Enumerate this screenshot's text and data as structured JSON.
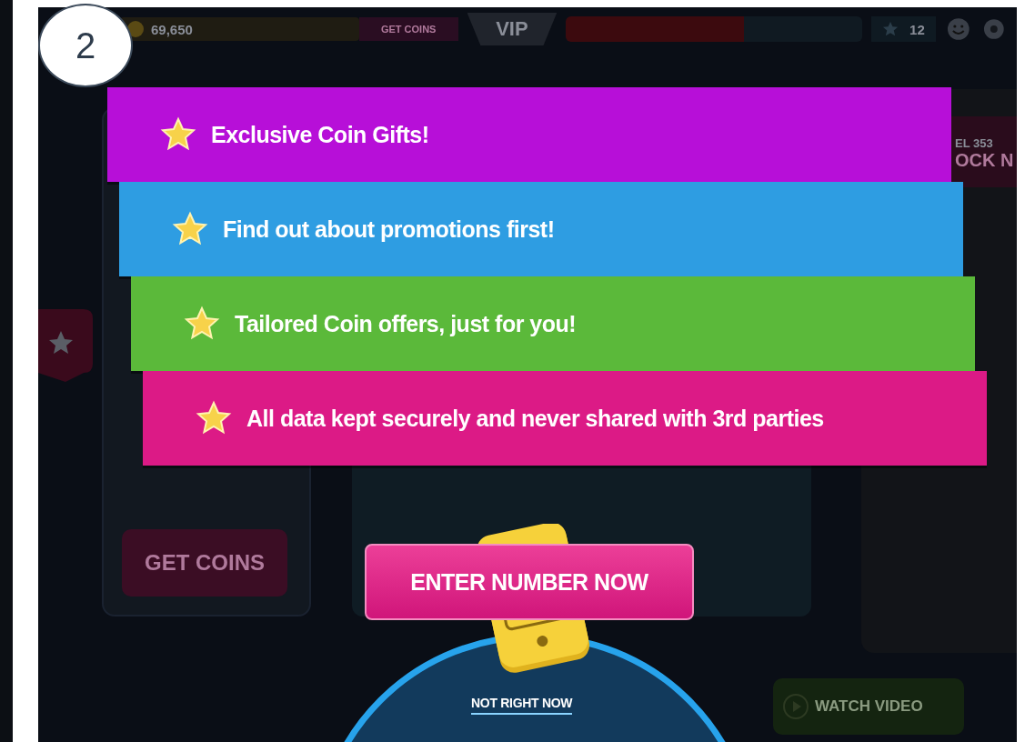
{
  "badge": {
    "number": "2"
  },
  "game": {
    "coins": "69,650",
    "get_coins_top": "GET COINS",
    "vip": "VIP",
    "level": "12",
    "right_card": {
      "level_text": "EL 353",
      "banner_text": "OCK N"
    },
    "left_card": {
      "button": "GET COINS"
    },
    "watch_video": "WATCH VIDEO"
  },
  "benefits": [
    {
      "text": "Exclusive Coin Gifts!",
      "color": "#b70fd8"
    },
    {
      "text": "Find out about promotions first!",
      "color": "#2e9de2"
    },
    {
      "text": "Tailored Coin offers, just for you!",
      "color": "#5bb93a"
    },
    {
      "text": "All data kept securely and never shared with 3rd parties",
      "color": "#dc1a86"
    }
  ],
  "primary_button": "ENTER NUMBER NOW",
  "secondary_link": "NOT RIGHT NOW"
}
